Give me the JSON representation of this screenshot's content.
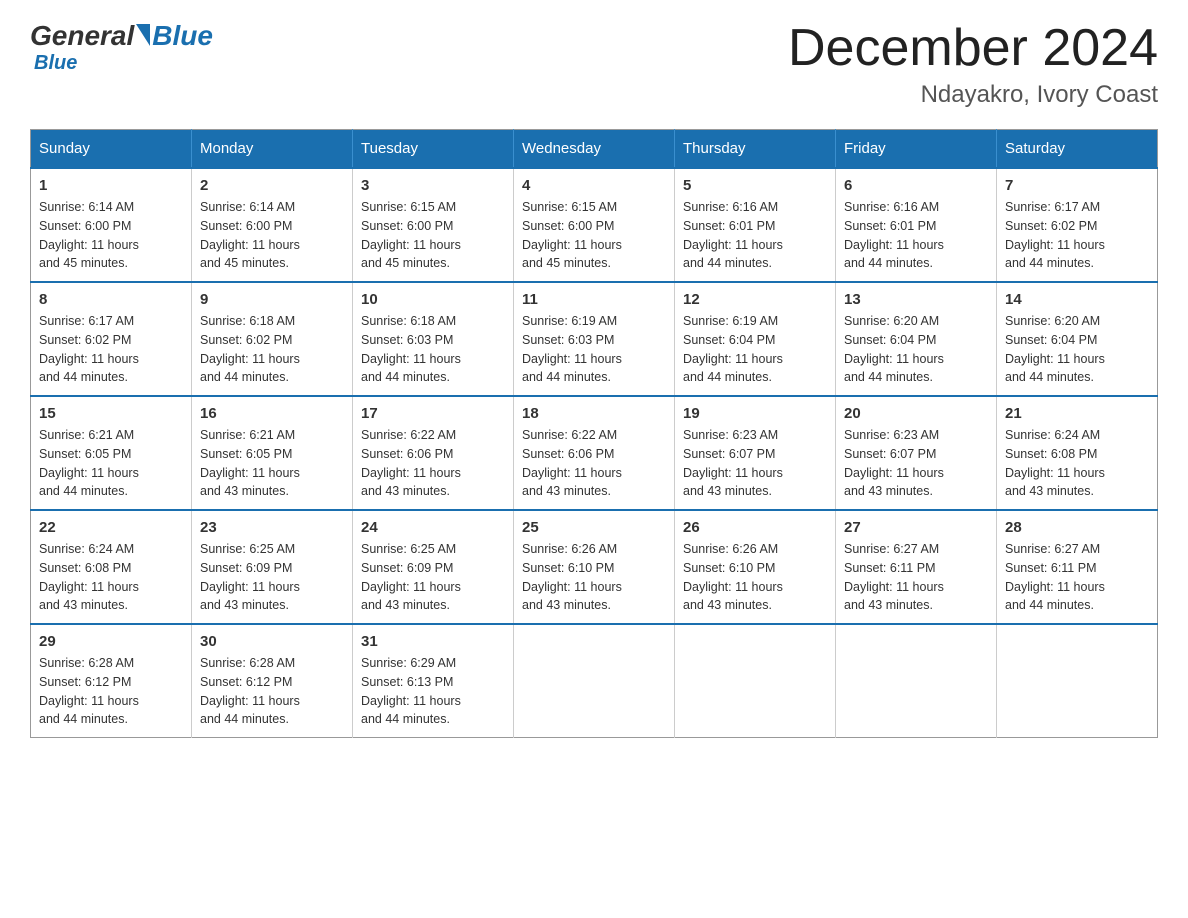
{
  "header": {
    "logo_general": "General",
    "logo_blue": "Blue",
    "main_title": "December 2024",
    "subtitle": "Ndayakro, Ivory Coast"
  },
  "days_of_week": [
    "Sunday",
    "Monday",
    "Tuesday",
    "Wednesday",
    "Thursday",
    "Friday",
    "Saturday"
  ],
  "weeks": [
    [
      {
        "day": "1",
        "sunrise": "6:14 AM",
        "sunset": "6:00 PM",
        "daylight": "11 hours and 45 minutes."
      },
      {
        "day": "2",
        "sunrise": "6:14 AM",
        "sunset": "6:00 PM",
        "daylight": "11 hours and 45 minutes."
      },
      {
        "day": "3",
        "sunrise": "6:15 AM",
        "sunset": "6:00 PM",
        "daylight": "11 hours and 45 minutes."
      },
      {
        "day": "4",
        "sunrise": "6:15 AM",
        "sunset": "6:00 PM",
        "daylight": "11 hours and 45 minutes."
      },
      {
        "day": "5",
        "sunrise": "6:16 AM",
        "sunset": "6:01 PM",
        "daylight": "11 hours and 44 minutes."
      },
      {
        "day": "6",
        "sunrise": "6:16 AM",
        "sunset": "6:01 PM",
        "daylight": "11 hours and 44 minutes."
      },
      {
        "day": "7",
        "sunrise": "6:17 AM",
        "sunset": "6:02 PM",
        "daylight": "11 hours and 44 minutes."
      }
    ],
    [
      {
        "day": "8",
        "sunrise": "6:17 AM",
        "sunset": "6:02 PM",
        "daylight": "11 hours and 44 minutes."
      },
      {
        "day": "9",
        "sunrise": "6:18 AM",
        "sunset": "6:02 PM",
        "daylight": "11 hours and 44 minutes."
      },
      {
        "day": "10",
        "sunrise": "6:18 AM",
        "sunset": "6:03 PM",
        "daylight": "11 hours and 44 minutes."
      },
      {
        "day": "11",
        "sunrise": "6:19 AM",
        "sunset": "6:03 PM",
        "daylight": "11 hours and 44 minutes."
      },
      {
        "day": "12",
        "sunrise": "6:19 AM",
        "sunset": "6:04 PM",
        "daylight": "11 hours and 44 minutes."
      },
      {
        "day": "13",
        "sunrise": "6:20 AM",
        "sunset": "6:04 PM",
        "daylight": "11 hours and 44 minutes."
      },
      {
        "day": "14",
        "sunrise": "6:20 AM",
        "sunset": "6:04 PM",
        "daylight": "11 hours and 44 minutes."
      }
    ],
    [
      {
        "day": "15",
        "sunrise": "6:21 AM",
        "sunset": "6:05 PM",
        "daylight": "11 hours and 44 minutes."
      },
      {
        "day": "16",
        "sunrise": "6:21 AM",
        "sunset": "6:05 PM",
        "daylight": "11 hours and 43 minutes."
      },
      {
        "day": "17",
        "sunrise": "6:22 AM",
        "sunset": "6:06 PM",
        "daylight": "11 hours and 43 minutes."
      },
      {
        "day": "18",
        "sunrise": "6:22 AM",
        "sunset": "6:06 PM",
        "daylight": "11 hours and 43 minutes."
      },
      {
        "day": "19",
        "sunrise": "6:23 AM",
        "sunset": "6:07 PM",
        "daylight": "11 hours and 43 minutes."
      },
      {
        "day": "20",
        "sunrise": "6:23 AM",
        "sunset": "6:07 PM",
        "daylight": "11 hours and 43 minutes."
      },
      {
        "day": "21",
        "sunrise": "6:24 AM",
        "sunset": "6:08 PM",
        "daylight": "11 hours and 43 minutes."
      }
    ],
    [
      {
        "day": "22",
        "sunrise": "6:24 AM",
        "sunset": "6:08 PM",
        "daylight": "11 hours and 43 minutes."
      },
      {
        "day": "23",
        "sunrise": "6:25 AM",
        "sunset": "6:09 PM",
        "daylight": "11 hours and 43 minutes."
      },
      {
        "day": "24",
        "sunrise": "6:25 AM",
        "sunset": "6:09 PM",
        "daylight": "11 hours and 43 minutes."
      },
      {
        "day": "25",
        "sunrise": "6:26 AM",
        "sunset": "6:10 PM",
        "daylight": "11 hours and 43 minutes."
      },
      {
        "day": "26",
        "sunrise": "6:26 AM",
        "sunset": "6:10 PM",
        "daylight": "11 hours and 43 minutes."
      },
      {
        "day": "27",
        "sunrise": "6:27 AM",
        "sunset": "6:11 PM",
        "daylight": "11 hours and 43 minutes."
      },
      {
        "day": "28",
        "sunrise": "6:27 AM",
        "sunset": "6:11 PM",
        "daylight": "11 hours and 44 minutes."
      }
    ],
    [
      {
        "day": "29",
        "sunrise": "6:28 AM",
        "sunset": "6:12 PM",
        "daylight": "11 hours and 44 minutes."
      },
      {
        "day": "30",
        "sunrise": "6:28 AM",
        "sunset": "6:12 PM",
        "daylight": "11 hours and 44 minutes."
      },
      {
        "day": "31",
        "sunrise": "6:29 AM",
        "sunset": "6:13 PM",
        "daylight": "11 hours and 44 minutes."
      },
      null,
      null,
      null,
      null
    ]
  ],
  "labels": {
    "sunrise": "Sunrise:",
    "sunset": "Sunset:",
    "daylight": "Daylight:"
  }
}
